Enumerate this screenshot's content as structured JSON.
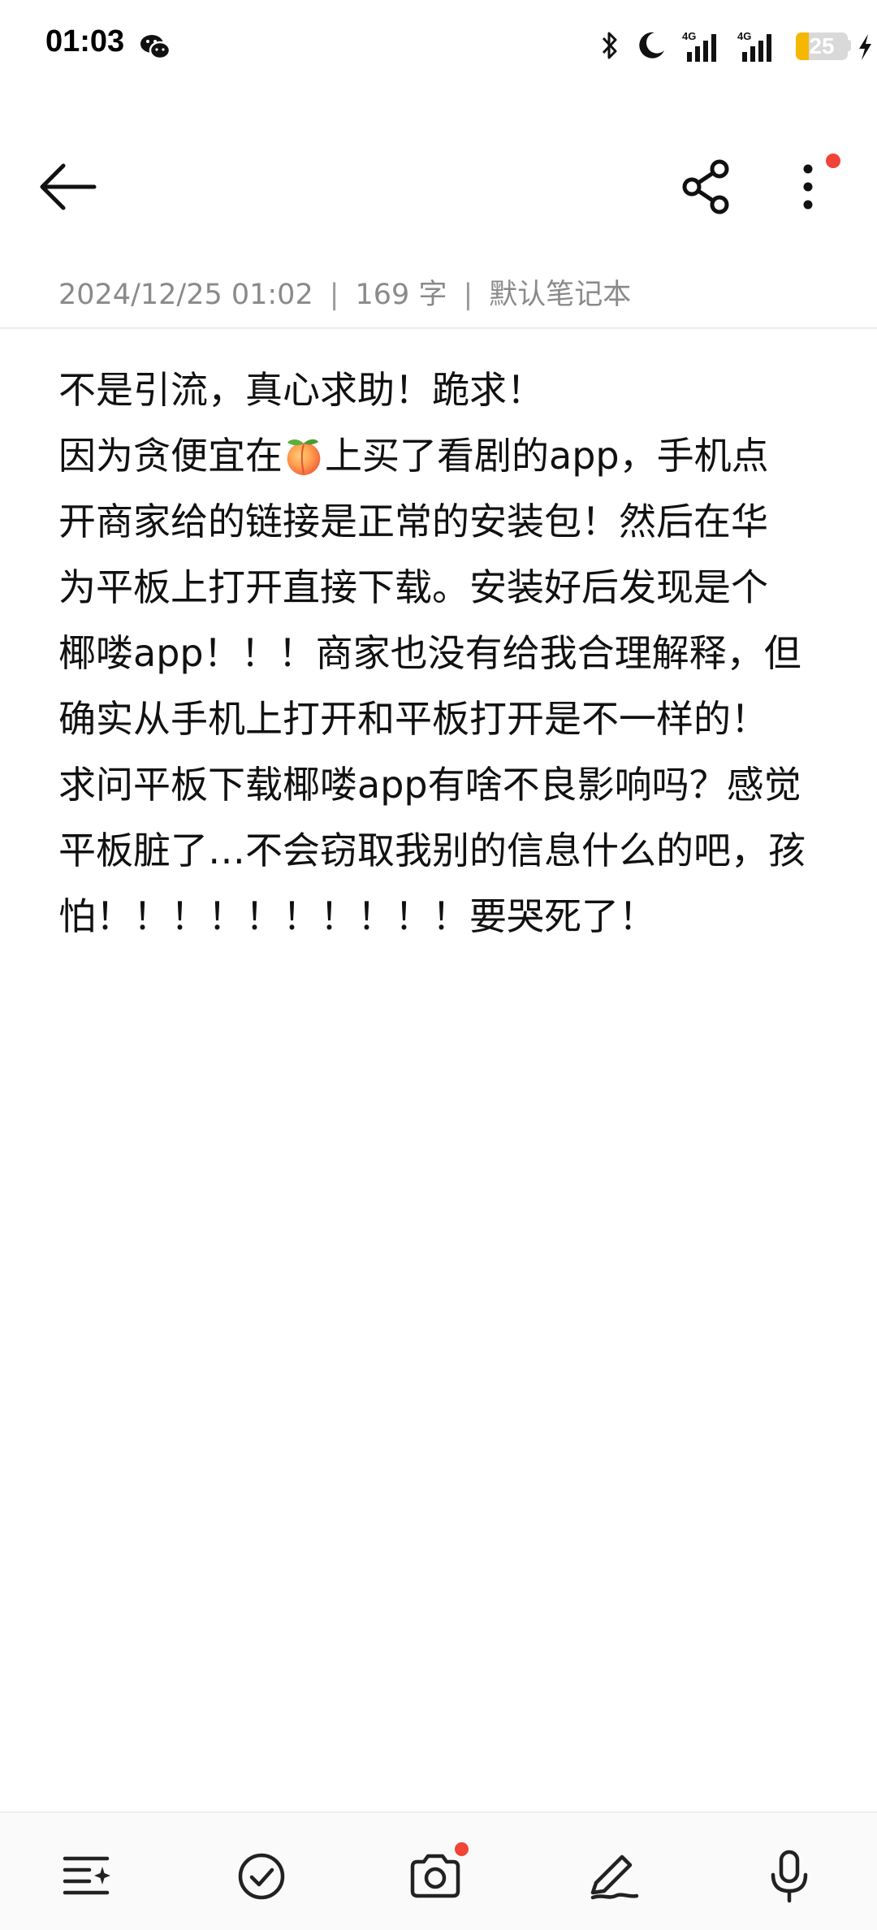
{
  "status_bar": {
    "time": "01:03",
    "battery_level": "25",
    "battery_fraction": 0.25,
    "network_labels": [
      "4G",
      "4G"
    ],
    "icons": [
      "wechat-icon",
      "bluetooth-icon",
      "do-not-disturb-moon-icon",
      "signal-icon",
      "signal-icon",
      "battery-icon",
      "charging-icon"
    ]
  },
  "toolbar": {
    "icons": [
      "back-arrow-icon",
      "share-icon",
      "more-vert-icon"
    ],
    "notification_dot_color": "#f04438"
  },
  "note": {
    "meta": {
      "date": "2024/12/25 01:02",
      "word_count": "169 字",
      "notebook": "默认笔记本",
      "separator": "|"
    },
    "lines": [
      {
        "text": "不是引流，真心求助！跪求！"
      },
      {
        "before": "因为贪便宜在",
        "emoji": "peach-icon",
        "after": "上买了看剧的app，手机点"
      },
      {
        "text": "开商家给的链接是正常的安装包！然后在华"
      },
      {
        "text": "为平板上打开直接下载。安装好后发现是个"
      },
      {
        "text": "椰喽app！！！商家也没有给我合理解释，但"
      },
      {
        "text": "确实从手机上打开和平板打开是不一样的！"
      },
      {
        "text": "求问平板下载椰喽app有啥不良影响吗？感觉"
      },
      {
        "text": "平板脏了…不会窃取我别的信息什么的吧，孩"
      },
      {
        "text": "怕！！！！！！！！！！要哭死了！"
      }
    ]
  },
  "bottom_bar": {
    "icons": [
      "format-list-icon",
      "checklist-icon",
      "camera-icon",
      "handwriting-pen-icon",
      "microphone-icon"
    ]
  },
  "colors": {
    "accent_red": "#f04438",
    "battery_yellow": "#f5b700",
    "meta_gray": "#8a8a8a"
  }
}
